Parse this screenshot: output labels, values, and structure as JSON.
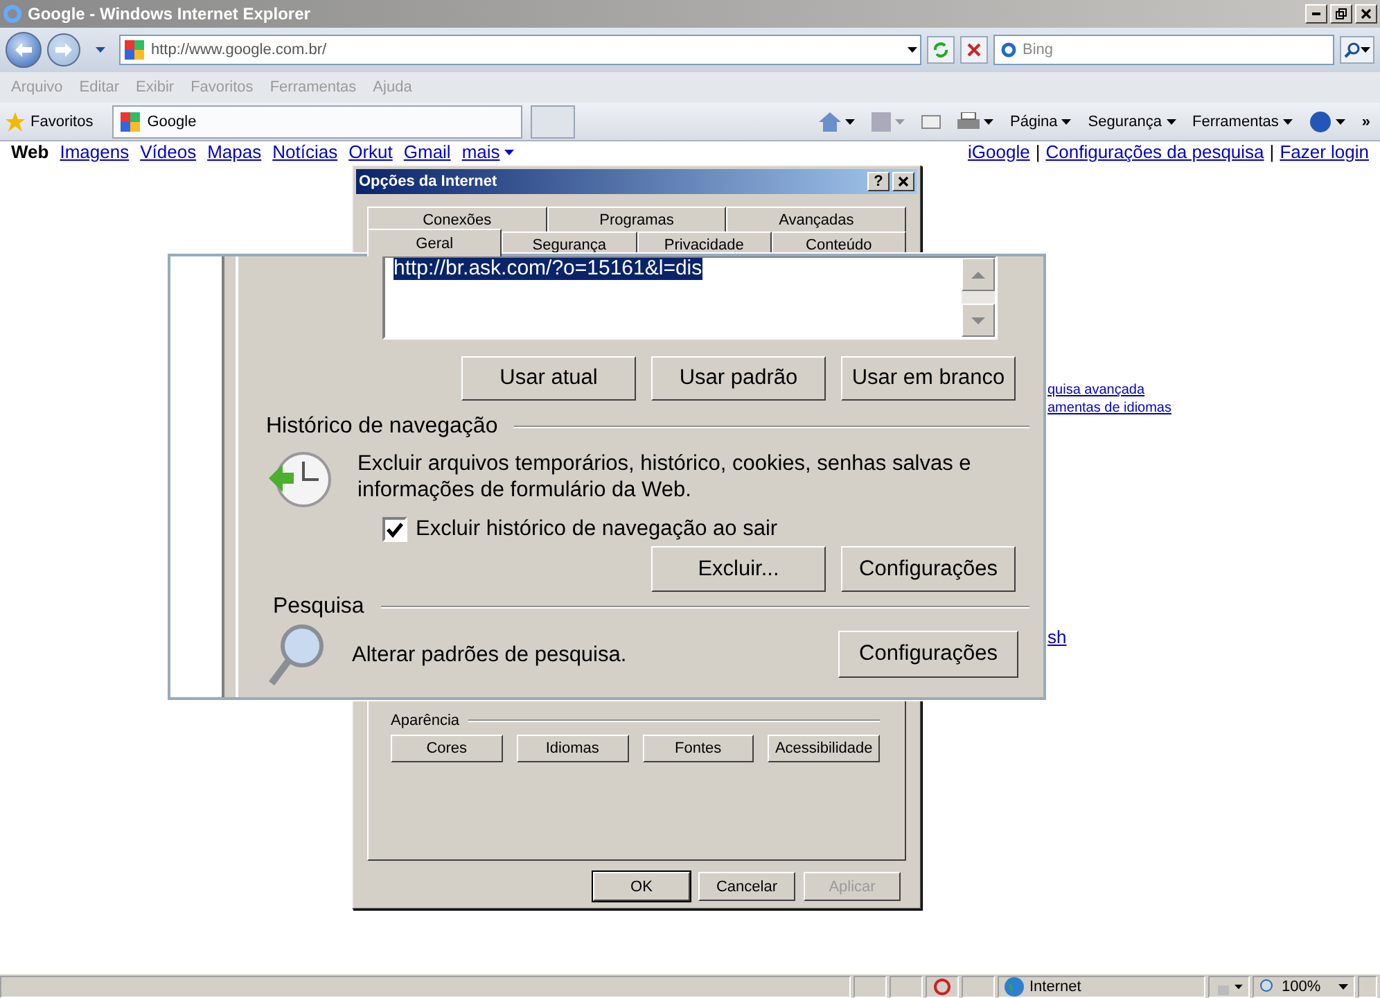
{
  "browser": {
    "title": "Google - Windows Internet Explorer",
    "address": "http://www.google.com.br/",
    "search_placeholder": "Bing",
    "menu": [
      {
        "label": "Arquivo",
        "disabled": true
      },
      {
        "label": "Editar",
        "disabled": true
      },
      {
        "label": "Exibir",
        "disabled": true
      },
      {
        "label": "Favoritos",
        "disabled": true
      },
      {
        "label": "Ferramentas",
        "disabled": true
      },
      {
        "label": "Ajuda",
        "disabled": true
      }
    ],
    "favorites_label": "Favoritos",
    "tabs": [
      {
        "label": "Google",
        "selected": true
      }
    ],
    "commands": [
      "Página",
      "Segurança",
      "Ferramentas"
    ],
    "overflow": "»"
  },
  "google_bar": {
    "services": [
      {
        "label": "Web",
        "selected": true
      },
      {
        "label": "Imagens",
        "selected": false
      },
      {
        "label": "Vídeos",
        "selected": false
      },
      {
        "label": "Mapas",
        "selected": false
      },
      {
        "label": "Notícias",
        "selected": false
      },
      {
        "label": "Orkut",
        "selected": false
      },
      {
        "label": "Gmail",
        "selected": false
      },
      {
        "label": "mais",
        "selected": false
      }
    ],
    "account": [
      {
        "kind": "link",
        "label": "iGoogle"
      },
      {
        "kind": "separator",
        "label": "|"
      },
      {
        "kind": "link",
        "label": "Configurações da pesquisa"
      },
      {
        "kind": "separator",
        "label": "|"
      },
      {
        "kind": "link",
        "label": "Fazer login"
      }
    ]
  },
  "page_links": [
    "quisa avançada",
    "amentas de idiomas",
    "sh"
  ],
  "dialog": {
    "title": "Opções da Internet",
    "help": "?",
    "tab_rows": [
      [
        {
          "label": "Conexões",
          "selected": false
        },
        {
          "label": "Programas",
          "selected": false
        },
        {
          "label": "Avançadas",
          "selected": false
        }
      ],
      [
        {
          "label": "Geral",
          "selected": true
        },
        {
          "label": "Segurança",
          "selected": false
        },
        {
          "label": "Privacidade",
          "selected": false
        },
        {
          "label": "Conteúdo",
          "selected": false
        }
      ]
    ],
    "appearance": {
      "title": "Aparência",
      "buttons": [
        "Cores",
        "Idiomas",
        "Fontes",
        "Acessibilidade"
      ]
    },
    "footer": [
      {
        "label": "OK",
        "disabled": false,
        "default": true
      },
      {
        "label": "Cancelar",
        "disabled": false,
        "default": false
      },
      {
        "label": "Aplicar",
        "disabled": true,
        "default": false
      }
    ]
  },
  "magnifier": {
    "home_page": {
      "url": "http://br.ask.com/?o=15161&l=dis",
      "buttons": [
        "Usar atual",
        "Usar padrão",
        "Usar em branco"
      ]
    },
    "history": {
      "title": "Histórico de navegação",
      "description": "Excluir arquivos temporários, histórico, cookies, senhas salvas e informações de formulário da Web.",
      "checkbox": {
        "label": "Excluir histórico de navegação ao sair",
        "checked": true
      },
      "buttons": [
        "Excluir...",
        "Configurações"
      ]
    },
    "search": {
      "title": "Pesquisa",
      "description": "Alterar padrões de pesquisa.",
      "button": "Configurações"
    }
  },
  "status_bar": {
    "zone": "Internet",
    "zoom": "100%"
  }
}
